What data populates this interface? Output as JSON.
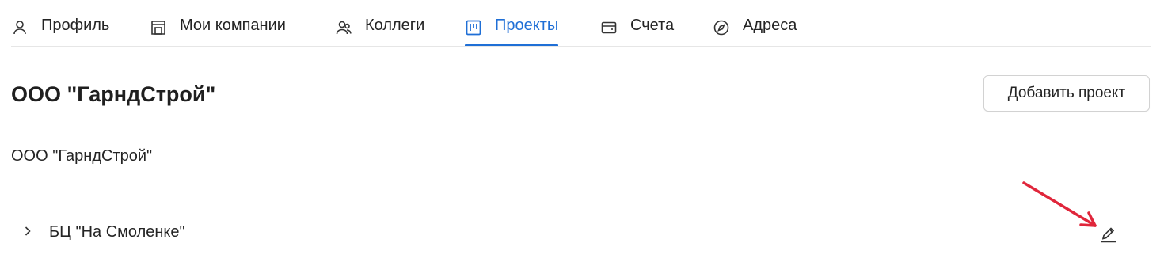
{
  "tabs": [
    {
      "label": "Профиль",
      "icon": "person-icon",
      "active": false
    },
    {
      "label": "Мои компании",
      "icon": "store-icon",
      "active": false
    },
    {
      "label": "Коллеги",
      "icon": "people-icon",
      "active": false
    },
    {
      "label": "Проекты",
      "icon": "board-icon",
      "active": true
    },
    {
      "label": "Счета",
      "icon": "wallet-icon",
      "active": false
    },
    {
      "label": "Адреса",
      "icon": "compass-icon",
      "active": false
    }
  ],
  "colors": {
    "accent": "#1f6fd6",
    "annotation_arrow": "#e0263b"
  },
  "company": {
    "title": "ООО \"ГарндСтрой\"",
    "subtitle": "ООО \"ГарндСтрой\""
  },
  "actions": {
    "add_project_label": "Добавить проект"
  },
  "projects": [
    {
      "name": "БЦ \"На Смоленке\"",
      "expanded": false
    }
  ]
}
